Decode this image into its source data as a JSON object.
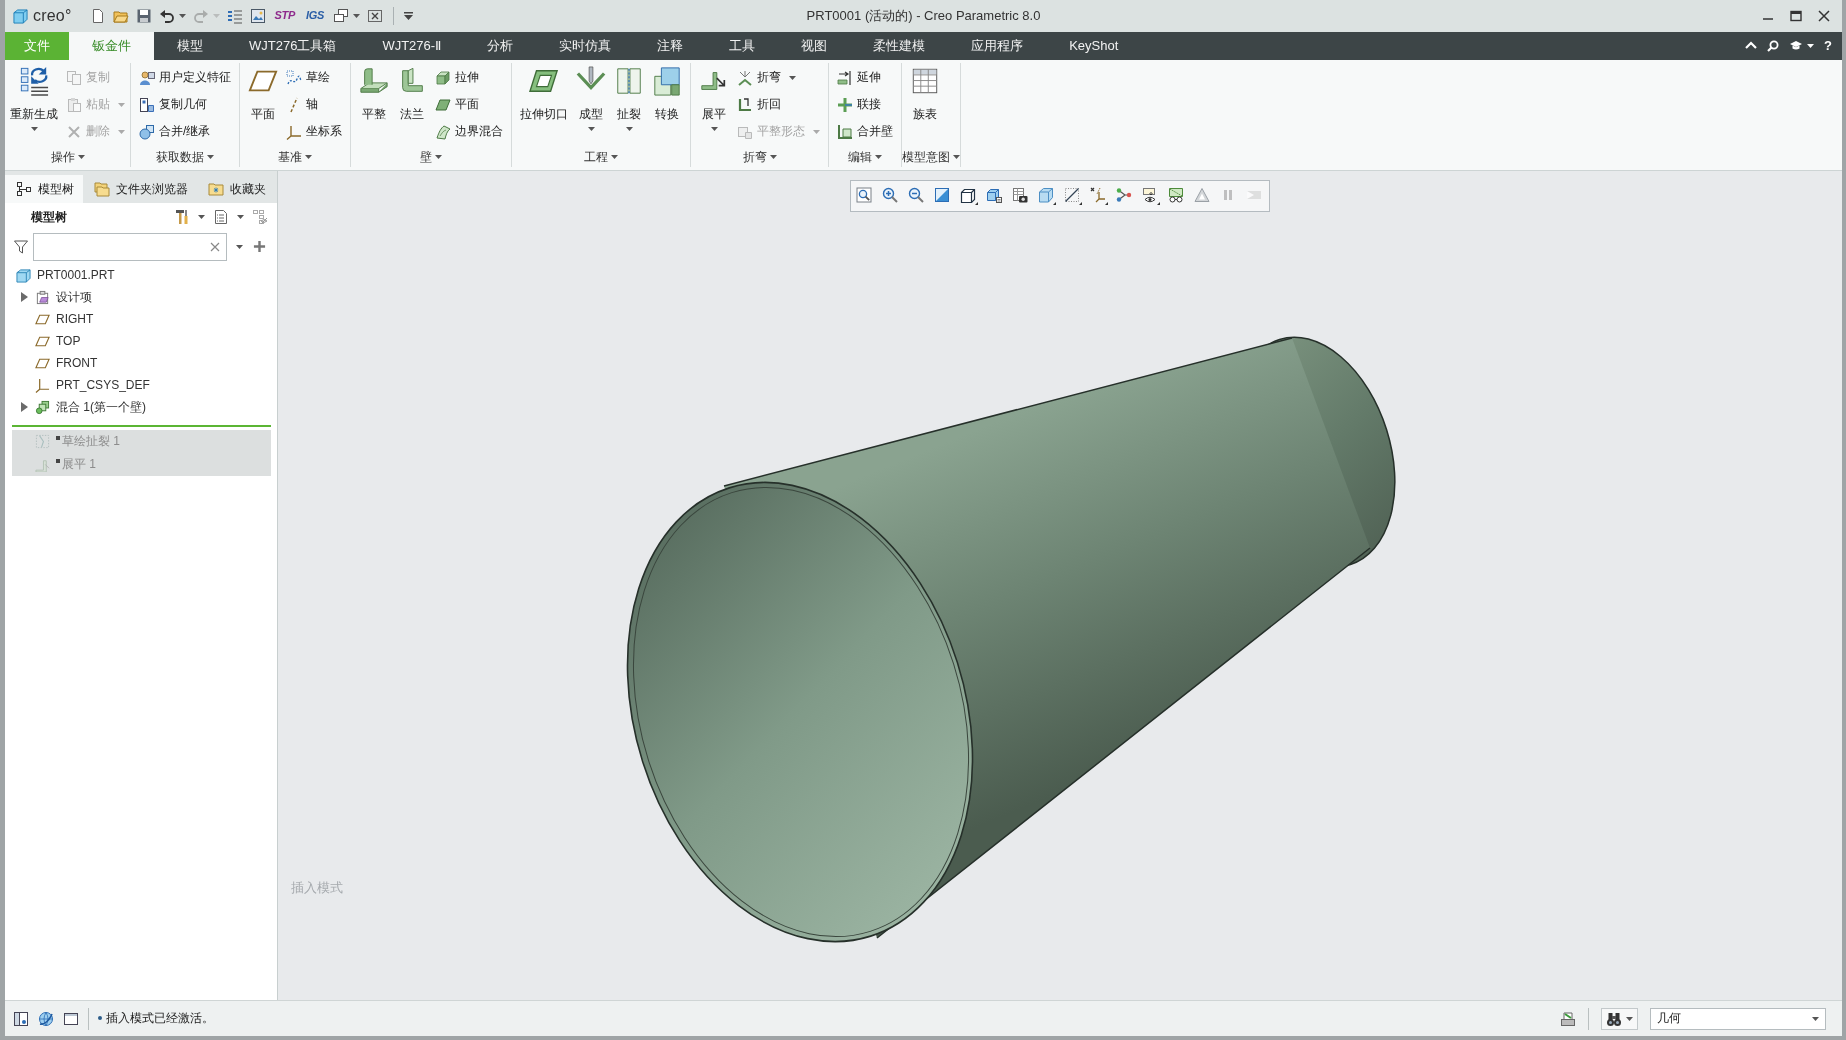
{
  "title_bar": {
    "logo": "creo°",
    "quick_access": [
      {
        "kind": "icon",
        "disabled": false,
        "dropdown": false
      },
      {
        "kind": "icon",
        "disabled": false,
        "dropdown": false
      },
      {
        "kind": "icon",
        "disabled": false,
        "dropdown": false
      },
      {
        "kind": "icon",
        "disabled": false,
        "dropdown": true
      },
      {
        "kind": "icon",
        "disabled": true,
        "dropdown": true
      },
      {
        "kind": "icon",
        "disabled": false,
        "dropdown": false
      },
      {
        "kind": "icon",
        "disabled": false,
        "dropdown": false
      },
      {
        "kind": "text",
        "label": "STP",
        "color": "#8e2a8c",
        "disabled": false,
        "dropdown": false
      },
      {
        "kind": "text",
        "label": "IGS",
        "color": "#2a5ea6",
        "disabled": false,
        "dropdown": false
      },
      {
        "kind": "icon",
        "disabled": false,
        "dropdown": true
      },
      {
        "kind": "icon",
        "disabled": false,
        "dropdown": false
      }
    ],
    "title": "PRT0001 (活动的) - Creo Parametric 8.0"
  },
  "menu_bar": {
    "tabs": [
      {
        "label": "文件",
        "kind": "file",
        "selected": false
      },
      {
        "label": "钣金件",
        "kind": "tab",
        "selected": true
      },
      {
        "label": "模型",
        "kind": "tab",
        "selected": false
      },
      {
        "label": "WJT276工具箱",
        "kind": "tab",
        "selected": false
      },
      {
        "label": "WJT276-Ⅱ",
        "kind": "tab",
        "selected": false
      },
      {
        "label": "分析",
        "kind": "tab",
        "selected": false
      },
      {
        "label": "实时仿真",
        "kind": "tab",
        "selected": false
      },
      {
        "label": "注释",
        "kind": "tab",
        "selected": false
      },
      {
        "label": "工具",
        "kind": "tab",
        "selected": false
      },
      {
        "label": "视图",
        "kind": "tab",
        "selected": false
      },
      {
        "label": "柔性建模",
        "kind": "tab",
        "selected": false
      },
      {
        "label": "应用程序",
        "kind": "tab",
        "selected": false
      },
      {
        "label": "KeyShot",
        "kind": "tab",
        "selected": false
      }
    ],
    "help": "?"
  },
  "ribbon": {
    "groups": [
      {
        "label": "操作",
        "items": [
          {
            "kind": "large",
            "label": "重新生成",
            "dropdown": true,
            "disabled": false
          },
          {
            "kind": "small",
            "label": "复制",
            "dropdown": false,
            "disabled": true
          },
          {
            "kind": "small",
            "label": "粘贴",
            "dropdown": true,
            "disabled": true
          },
          {
            "kind": "small",
            "label": "删除",
            "dropdown": true,
            "disabled": true
          }
        ]
      },
      {
        "label": "获取数据",
        "items": [
          {
            "kind": "small",
            "label": "用户定义特征",
            "dropdown": false,
            "disabled": false
          },
          {
            "kind": "small",
            "label": "复制几何",
            "dropdown": false,
            "disabled": false
          },
          {
            "kind": "small",
            "label": "合并/继承",
            "dropdown": false,
            "disabled": false
          }
        ]
      },
      {
        "label": "基准",
        "items": [
          {
            "kind": "large",
            "label": "平面",
            "dropdown": false,
            "disabled": false
          },
          {
            "kind": "small",
            "label": "草绘",
            "dropdown": false,
            "disabled": false
          },
          {
            "kind": "small",
            "label": "轴",
            "dropdown": false,
            "disabled": false
          },
          {
            "kind": "small",
            "label": "坐标系",
            "dropdown": false,
            "disabled": false
          }
        ]
      },
      {
        "label": "壁",
        "items": [
          {
            "kind": "large",
            "label": "平整",
            "dropdown": false,
            "disabled": false
          },
          {
            "kind": "large",
            "label": "法兰",
            "dropdown": false,
            "disabled": false
          },
          {
            "kind": "small",
            "label": "拉伸",
            "dropdown": false,
            "disabled": false
          },
          {
            "kind": "small",
            "label": "平面",
            "dropdown": false,
            "disabled": false
          },
          {
            "kind": "small",
            "label": "边界混合",
            "dropdown": false,
            "disabled": false
          }
        ]
      },
      {
        "label": "工程",
        "items": [
          {
            "kind": "large",
            "label": "拉伸切口",
            "dropdown": false,
            "disabled": false
          },
          {
            "kind": "large",
            "label": "成型",
            "dropdown": true,
            "disabled": false
          },
          {
            "kind": "large",
            "label": "扯裂",
            "dropdown": true,
            "disabled": false
          },
          {
            "kind": "large",
            "label": "转换",
            "dropdown": false,
            "disabled": false
          }
        ]
      },
      {
        "label": "折弯",
        "items": [
          {
            "kind": "large",
            "label": "展平",
            "dropdown": true,
            "disabled": false
          },
          {
            "kind": "small",
            "label": "折弯",
            "dropdown": true,
            "disabled": false
          },
          {
            "kind": "small",
            "label": "折回",
            "dropdown": false,
            "disabled": false
          },
          {
            "kind": "small",
            "label": "平整形态",
            "dropdown": true,
            "disabled": true
          }
        ]
      },
      {
        "label": "编辑",
        "items": [
          {
            "kind": "small",
            "label": "延伸",
            "dropdown": false,
            "disabled": false
          },
          {
            "kind": "small",
            "label": "联接",
            "dropdown": false,
            "disabled": false
          },
          {
            "kind": "small",
            "label": "合并壁",
            "dropdown": false,
            "disabled": false
          }
        ]
      },
      {
        "label": "模型意图",
        "items": [
          {
            "kind": "large",
            "label": "族表",
            "dropdown": false,
            "disabled": false
          }
        ]
      }
    ]
  },
  "model_tree_panel": {
    "tabs": [
      {
        "label": "模型树",
        "selected": true
      },
      {
        "label": "文件夹浏览器",
        "selected": false
      },
      {
        "label": "收藏夹",
        "selected": false
      }
    ],
    "title": "模型树",
    "tree": [
      {
        "label": "PRT0001.PRT",
        "expandable": false,
        "inactive": false,
        "children": [
          {
            "label": "设计项",
            "expandable": true,
            "inactive": false
          },
          {
            "label": "RIGHT",
            "expandable": false,
            "inactive": false
          },
          {
            "label": "TOP",
            "expandable": false,
            "inactive": false
          },
          {
            "label": "FRONT",
            "expandable": false,
            "inactive": false
          },
          {
            "label": "PRT_CSYS_DEF",
            "expandable": false,
            "inactive": false
          },
          {
            "label": "混合 1(第一个壁)",
            "expandable": true,
            "inactive": false
          },
          {
            "label": "草绘扯裂 1",
            "expandable": false,
            "inactive": true
          },
          {
            "label": "展平 1",
            "expandable": false,
            "inactive": true
          }
        ]
      }
    ]
  },
  "graphics": {
    "view_toolbar": [
      {
        "dropdown": false,
        "disabled": false
      },
      {
        "dropdown": false,
        "disabled": false
      },
      {
        "dropdown": false,
        "disabled": false
      },
      {
        "dropdown": false,
        "disabled": false
      },
      {
        "dropdown": true,
        "disabled": false
      },
      {
        "dropdown": false,
        "disabled": false
      },
      {
        "dropdown": false,
        "disabled": false
      },
      {
        "dropdown": true,
        "disabled": false
      },
      {
        "dropdown": true,
        "disabled": false
      },
      {
        "dropdown": true,
        "disabled": false
      },
      {
        "dropdown": false,
        "disabled": false
      },
      {
        "dropdown": true,
        "disabled": false
      },
      {
        "dropdown": false,
        "disabled": false
      },
      {
        "dropdown": false,
        "disabled": false
      },
      {
        "dropdown": false,
        "disabled": true
      },
      {
        "dropdown": false,
        "disabled": true
      }
    ],
    "mode": "插入模式"
  },
  "status_bar": {
    "message": "插入模式已经激活。",
    "selection_filter": "几何"
  }
}
